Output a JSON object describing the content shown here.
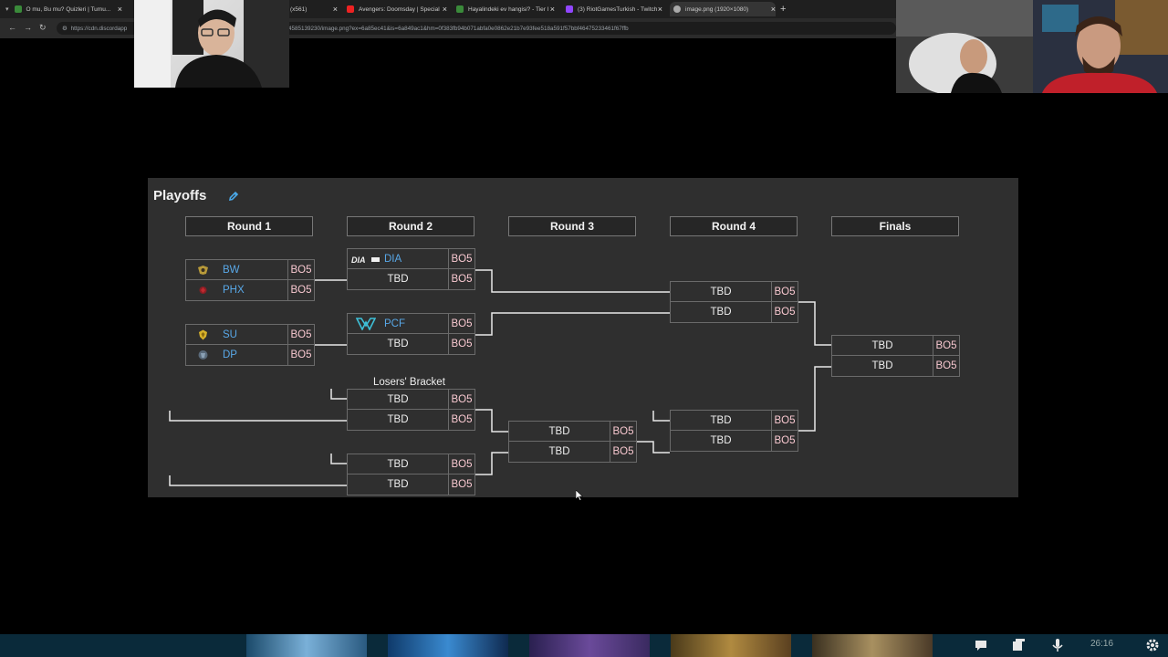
{
  "browser": {
    "tabs": [
      {
        "label": "O mu, Bu mu? Quizleri | Tumu...",
        "fav": "#3a8a3a"
      },
      {
        "label": "...",
        "fav": "#c33"
      },
      {
        "label": "(x561)",
        "fav": "#888"
      },
      {
        "label": "Avengers: Doomsday | Special",
        "fav": "#e22"
      },
      {
        "label": "Hayalindeki ev hangisi? - Tier l",
        "fav": "#3a8a3a"
      },
      {
        "label": "(3) RiotGamesTurkish - Twitch",
        "fav": "#9146ff"
      },
      {
        "label": "image.png (1920×1080)",
        "fav": "#aaa"
      }
    ],
    "new_tab": "+",
    "url_left": "https://cdn.discordapp",
    "url_right": "4585139230/image.png?ex=6a85ec41&is=6a849ac1&hm=0f383fb94b071abfa0e0862e21b7e93fee518a591f57bbf46475233461f67ffb"
  },
  "bracket": {
    "title": "Playoffs",
    "rounds": [
      "Round 1",
      "Round 2",
      "Round 3",
      "Round 4",
      "Finals"
    ],
    "losers_label": "Losers' Bracket",
    "bo": "BO5",
    "tbd": "TBD",
    "teams": {
      "bw": "BW",
      "phx": "PHX",
      "su": "SU",
      "dp": "DP",
      "dia": "DIA",
      "pcf": "PCF"
    },
    "colors": {
      "team_link": "#58a8e8",
      "bo_text": "#f8c8d0",
      "panel": "#2f2f2f"
    }
  },
  "taskbar": {
    "clock": "26:16"
  }
}
